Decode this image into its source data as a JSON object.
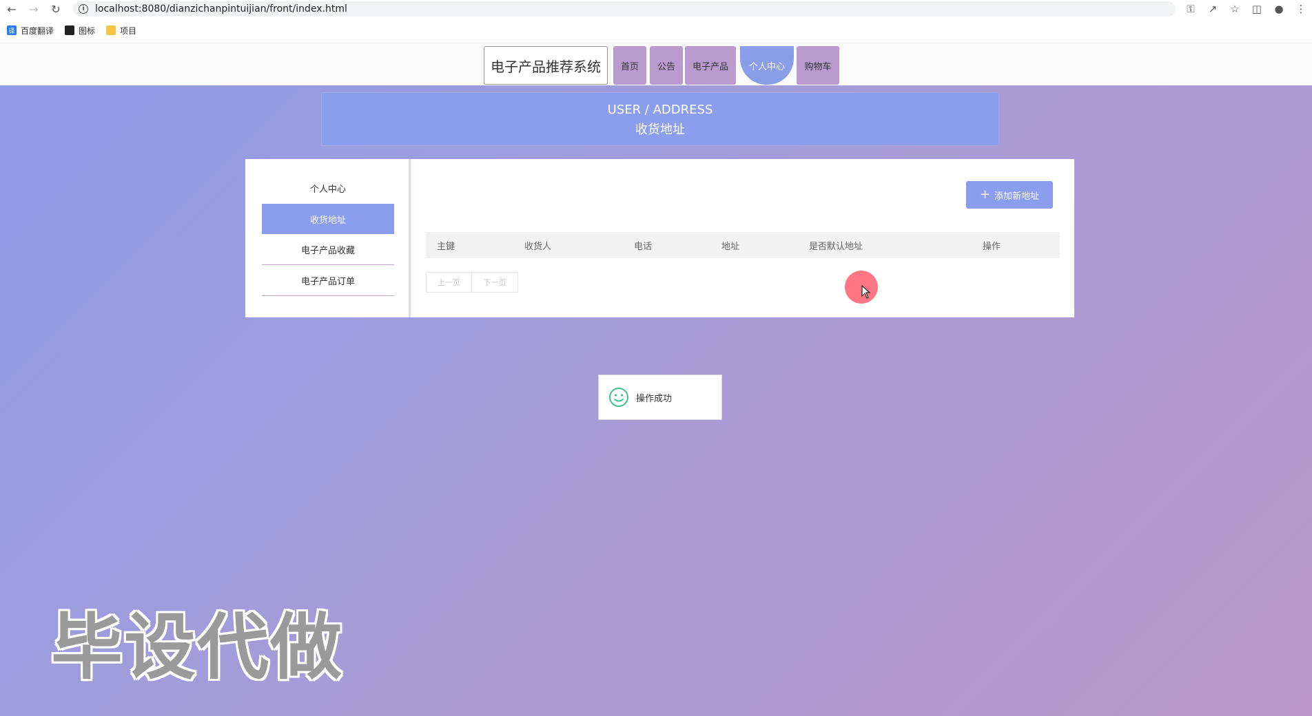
{
  "browser": {
    "url": "localhost:8080/dianzichanpintuijian/front/index.html",
    "bookmarks": [
      {
        "label": "百度翻译",
        "icon": "fanyi-icon"
      },
      {
        "label": "图标",
        "icon": "image-icon"
      },
      {
        "label": "项目",
        "icon": "folder-icon"
      }
    ]
  },
  "header": {
    "brand": "电子产品推荐系统",
    "nav": [
      {
        "label": "首页"
      },
      {
        "label": "公告"
      },
      {
        "label": "电子产品"
      },
      {
        "label": "个人中心",
        "active": true
      },
      {
        "label": "购物车"
      }
    ]
  },
  "banner": {
    "en": "USER / ADDRESS",
    "zh": "收货地址"
  },
  "sidebar": {
    "items": [
      {
        "label": "个人中心"
      },
      {
        "label": "收货地址",
        "active": true
      },
      {
        "label": "电子产品收藏"
      },
      {
        "label": "电子产品订单"
      }
    ]
  },
  "main": {
    "add_button": "添加新地址",
    "table": {
      "columns": [
        "主键",
        "收货人",
        "电话",
        "地址",
        "是否默认地址",
        "操作"
      ],
      "rows": []
    },
    "pager": {
      "prev": "上一页",
      "next": "下一页"
    }
  },
  "toast": {
    "message": "操作成功"
  },
  "watermark": "毕设代做",
  "colors": {
    "accent": "#8b9eed",
    "nav_bg": "#b99bd0",
    "bg_start": "#8f9ce9",
    "bg_end": "#bd97ca"
  }
}
